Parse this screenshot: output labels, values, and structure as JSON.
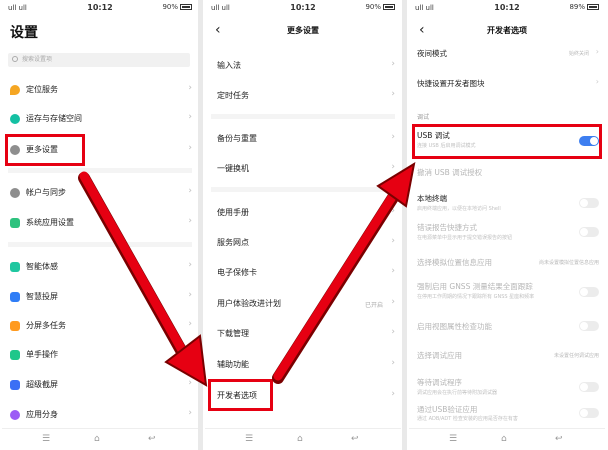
{
  "status": {
    "p1": {
      "time": "10:12",
      "signal": "ull ull",
      "battery": "90%"
    },
    "p2": {
      "time": "10:12",
      "signal": "ull ull",
      "battery": "90%"
    },
    "p3": {
      "time": "10:12",
      "signal": "ull ull",
      "battery": "89%"
    }
  },
  "screen1": {
    "title": "设置",
    "search_placeholder": "搜索设置项",
    "items": [
      {
        "label": "定位服务",
        "icon": "location-icon",
        "color": "#f5a623"
      },
      {
        "label": "运存与存储空间",
        "icon": "storage-icon",
        "color": "#14c0a3"
      },
      {
        "label": "更多设置",
        "icon": "gear-icon",
        "color": "#8e8e8e"
      },
      {
        "label": "帐户与同步",
        "icon": "account-icon",
        "color": "#8e8e8e"
      },
      {
        "label": "系统应用设置",
        "icon": "apps-icon",
        "color": "#2ec27e"
      },
      {
        "label": "智能体感",
        "icon": "motion-icon",
        "color": "#1fc7a0"
      },
      {
        "label": "智慧投屏",
        "icon": "cast-icon",
        "color": "#2f7df6"
      },
      {
        "label": "分屏多任务",
        "icon": "split-icon",
        "color": "#ff9a1f"
      },
      {
        "label": "单手操作",
        "icon": "one-hand-icon",
        "color": "#1fc78a"
      },
      {
        "label": "超级截屏",
        "icon": "screenshot-icon",
        "color": "#3b6ff5"
      },
      {
        "label": "应用分身",
        "icon": "clone-icon",
        "color": "#9c5cf5"
      }
    ]
  },
  "screen2": {
    "title": "更多设置",
    "items": [
      {
        "label": "输入法"
      },
      {
        "label": "定时任务"
      },
      {
        "label": "备份与重置"
      },
      {
        "label": "一键换机"
      },
      {
        "label": "使用手册"
      },
      {
        "label": "服务网点"
      },
      {
        "label": "电子保修卡"
      },
      {
        "label": "用户体验改进计划",
        "value": "已开启"
      },
      {
        "label": "下载管理"
      },
      {
        "label": "辅助功能"
      },
      {
        "label": "开发者选项"
      }
    ]
  },
  "screen3": {
    "title": "开发者选项",
    "items": [
      {
        "label": "夜间模式",
        "value": "始终关闭"
      },
      {
        "label": "快捷设置开发者图块"
      },
      {
        "section": "调试"
      },
      {
        "label": "USB 调试",
        "sub": "连接 USB 后启用调试模式",
        "toggle": true
      },
      {
        "label": "撤消 USB 调试授权"
      },
      {
        "label": "本地终端",
        "sub": "启用终端应用，以便在本地访问 Shell",
        "toggle": false
      },
      {
        "label": "错误报告快捷方式",
        "sub": "在电源菜单中显示用于提交错误报告的按钮",
        "toggle": false
      },
      {
        "label": "选择模拟位置信息应用",
        "value": "尚未设置模拟位置信息应用"
      },
      {
        "label": "强制启用 GNSS 测量结果全面跟踪",
        "sub": "在停用工作周期的情况下跟踪所有 GNSS 星座和频率",
        "toggle": false
      },
      {
        "label": "启用视图属性检查功能",
        "toggle": false
      },
      {
        "label": "选择调试应用",
        "value": "未设置任何调试应用"
      },
      {
        "label": "等待调试程序",
        "sub": "调试应用会在执行前等待附加调试器",
        "toggle": false
      },
      {
        "label": "通过USB验证应用",
        "sub": "通过 ADB/ADT 检查安装的应用是否存在有害",
        "toggle": false
      }
    ]
  },
  "nav_buttons": {
    "menu": "☰",
    "home": "⌂",
    "back": "↩"
  },
  "colors": {
    "highlight": "#e60012",
    "toggle_on": "#3d7ef0",
    "arrow": "#e60012"
  }
}
